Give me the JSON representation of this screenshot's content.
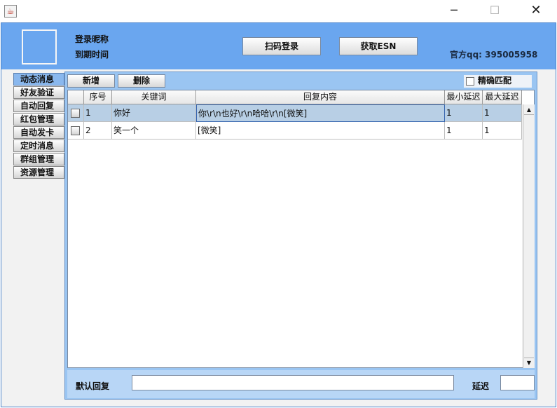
{
  "window": {
    "minimize": "─",
    "maximize": "☐",
    "close": "✕"
  },
  "header": {
    "nickname_label": "登录昵称",
    "expire_label": "到期时间",
    "scan_login_button": "扫码登录",
    "get_esn_button": "获取ESN",
    "official_qq": "官方qq: 395005958"
  },
  "tabs": [
    {
      "label": "动态消息",
      "selected": true
    },
    {
      "label": "好友验证",
      "selected": false
    },
    {
      "label": "自动回复",
      "selected": false
    },
    {
      "label": "红包管理",
      "selected": false
    },
    {
      "label": "自动发卡",
      "selected": false
    },
    {
      "label": "定时消息",
      "selected": false
    },
    {
      "label": "群组管理",
      "selected": false
    },
    {
      "label": "资源管理",
      "selected": false
    }
  ],
  "toolbar": {
    "add_button": "新增",
    "delete_button": "删除",
    "exact_match_label": "精确匹配",
    "exact_match_checked": false
  },
  "table": {
    "columns": [
      "",
      "序号",
      "关键词",
      "回复内容",
      "最小延迟",
      "最大延迟"
    ],
    "rows": [
      {
        "checked": false,
        "index": "1",
        "keyword": "你好",
        "reply": "你\\r\\n也好\\r\\n哈哈\\r\\n[微笑]",
        "min_delay": "1",
        "max_delay": "1",
        "selected": true
      },
      {
        "checked": false,
        "index": "2",
        "keyword": "笑一个",
        "reply": "[微笑]",
        "min_delay": "1",
        "max_delay": "1",
        "selected": false
      }
    ]
  },
  "bottom": {
    "default_reply_label": "默认回复",
    "default_reply_value": "",
    "delay_label": "延迟",
    "delay_value": ""
  },
  "scroll": {
    "up_arrow": "▲",
    "down_arrow": "▼"
  }
}
